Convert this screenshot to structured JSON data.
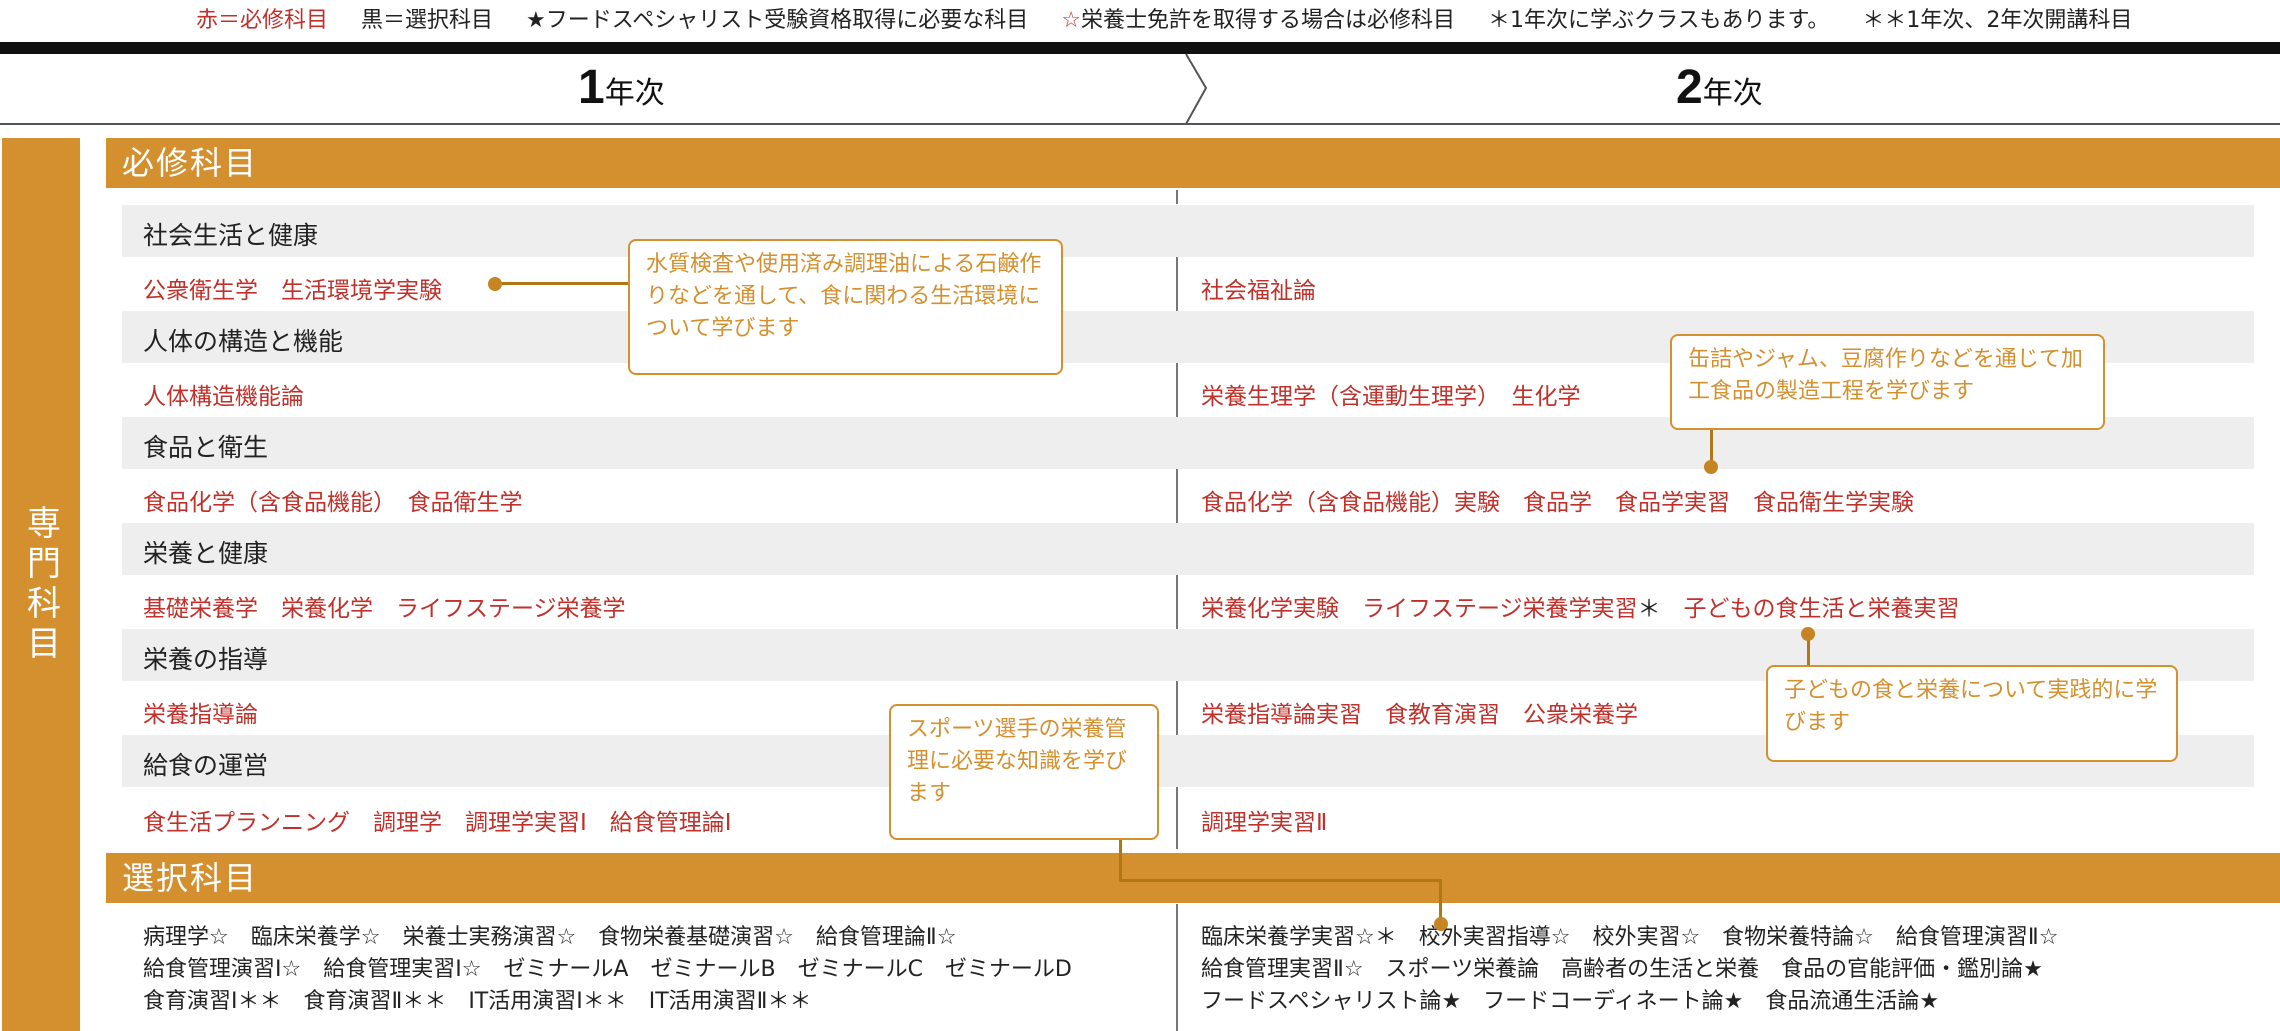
{
  "legend": {
    "red": "赤＝必修科目",
    "black": "黒＝選択科目",
    "star": "★フードスペシャリスト受験資格取得に必要な科目",
    "openstar": "☆栄養士免許を取得する場合は必修科目",
    "asterisk": "＊1年次に学ぶクラスもあります。",
    "double": "＊＊1年次、2年次開講科目"
  },
  "years": {
    "y1_num": "1",
    "y1_unit": "年次",
    "y2_num": "2",
    "y2_unit": "年次"
  },
  "side_label": "専門科目",
  "sections": {
    "required": "必修科目",
    "elective": "選択科目"
  },
  "categories": [
    "社会生活と健康",
    "人体の構造と機能",
    "食品と衛生",
    "栄養と健康",
    "栄養の指導",
    "給食の運営"
  ],
  "year1": {
    "r0": "公衆衛生学　生活環境学実験",
    "r1": "人体構造機能論",
    "r2": "食品化学（含食品機能）　食品衛生学",
    "r3": "基礎栄養学　栄養化学　ライフステージ栄養学",
    "r4": "栄養指導論",
    "r5": "食生活プランニング　調理学　調理学実習Ⅰ　給食管理論Ⅰ"
  },
  "year2": {
    "r0": "社会福祉論",
    "r1": "栄養生理学（含運動生理学）　生化学",
    "r2": "食品化学（含食品機能）実験　食品学　食品学実習　食品衛生学実験",
    "r3a": "栄養化学実験　ライフステージ栄養学実習",
    "r3b": "＊",
    "r3c": "子どもの食生活と栄養実習",
    "r4": "栄養指導論実習　食教育演習　公衆栄養学",
    "r5": "調理学実習Ⅱ"
  },
  "elective": {
    "y1": [
      "病理学☆　臨床栄養学☆　栄養士実務演習☆　食物栄養基礎演習☆　給食管理論Ⅱ☆",
      "給食管理演習Ⅰ☆　給食管理実習Ⅰ☆　ゼミナールA　ゼミナールB　ゼミナールC　ゼミナールD",
      "食育演習Ⅰ＊＊　食育演習Ⅱ＊＊　IT活用演習Ⅰ＊＊　IT活用演習Ⅱ＊＊"
    ],
    "y2": [
      "臨床栄養学実習☆＊　校外実習指導☆　校外実習☆　食物栄養特論☆　給食管理演習Ⅱ☆",
      "給食管理実習Ⅱ☆　スポーツ栄養論　高齢者の生活と栄養　食品の官能評価・鑑別論★",
      "フードスペシャリスト論★　フードコーディネート論★　食品流通生活論★"
    ]
  },
  "notes": {
    "n1": "水質検査や使用済み調理油による石鹸作りなどを通して、食に関わる生活環境について学びます",
    "n2": "缶詰やジャム、豆腐作りなどを通じて加工食品の製造工程を学びます",
    "n3": "子どもの食と栄養について実践的に学びます",
    "n4": "スポーツ選手の栄養管理に必要な知識を学びます"
  },
  "colors": {
    "accent": "#d4902f",
    "required_text": "#c0312b",
    "black_bar": "#111111"
  }
}
